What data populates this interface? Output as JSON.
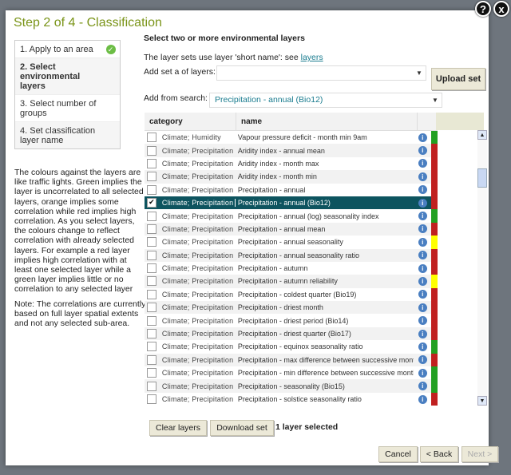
{
  "dialog": {
    "title": "Step 2 of 4 - Classification",
    "help_icon": "?",
    "close_icon": "x"
  },
  "steps": [
    {
      "label": "1. Apply to an area",
      "done": true
    },
    {
      "label": "2. Select environmental layers",
      "current": true
    },
    {
      "label": "3. Select number of groups"
    },
    {
      "label": "4. Set classification layer name"
    }
  ],
  "info": {
    "para1": "The colours against the layers are like traffic lights. Green implies the layer is uncorrelated to all selected layers, orange implies some correlation while red implies high correlation. As you select layers, the colours change to reflect correlation with already selected layers. For example a red layer implies high correlation with at least one selected layer while a green layer implies little or no correlation to any selected layer",
    "para2": "Note: The correlations are currently based on full layer spatial extents and not any selected sub-area."
  },
  "main": {
    "heading": "Select two or more environmental layers",
    "layer_sets_text": "The layer sets use layer 'short name': see ",
    "layer_sets_link": "layers",
    "add_set_label": "Add set a of layers:",
    "add_set_value": "",
    "upload_button": "Upload set",
    "search_label": "Add from search:",
    "search_value": "Precipitation - annual (Bio12)"
  },
  "grid": {
    "headers": {
      "category": "category",
      "name": "name"
    },
    "colors": {
      "green": "#22a022",
      "red": "#c02020",
      "yellow": "#ffff00"
    },
    "rows": [
      {
        "category": "Climate; Humidity",
        "name": "Vapour pressure deficit - month min 9am",
        "checked": false,
        "corr": "green"
      },
      {
        "category": "Climate; Precipitation",
        "name": "Aridity index - annual mean",
        "checked": false,
        "corr": "red"
      },
      {
        "category": "Climate; Precipitation",
        "name": "Aridity index - month max",
        "checked": false,
        "corr": "red"
      },
      {
        "category": "Climate; Precipitation",
        "name": "Aridity index - month min",
        "checked": false,
        "corr": "red"
      },
      {
        "category": "Climate; Precipitation",
        "name": "Precipitation - annual",
        "checked": false,
        "corr": "red"
      },
      {
        "category": "Climate; Precipitation",
        "name": "Precipitation - annual (Bio12)",
        "checked": true,
        "corr": "red",
        "selected": true
      },
      {
        "category": "Climate; Precipitation",
        "name": "Precipitation - annual (log) seasonality index",
        "checked": false,
        "corr": "green"
      },
      {
        "category": "Climate; Precipitation",
        "name": "Precipitation - annual mean",
        "checked": false,
        "corr": "red"
      },
      {
        "category": "Climate; Precipitation",
        "name": "Precipitation - annual seasonality",
        "checked": false,
        "corr": "yellow"
      },
      {
        "category": "Climate; Precipitation",
        "name": "Precipitation - annual seasonality ratio",
        "checked": false,
        "corr": "red"
      },
      {
        "category": "Climate; Precipitation",
        "name": "Precipitation - autumn",
        "checked": false,
        "corr": "red"
      },
      {
        "category": "Climate; Precipitation",
        "name": "Precipitation - autumn reliability",
        "checked": false,
        "corr": "yellow"
      },
      {
        "category": "Climate; Precipitation",
        "name": "Precipitation - coldest quarter (Bio19)",
        "checked": false,
        "corr": "red"
      },
      {
        "category": "Climate; Precipitation",
        "name": "Precipitation - driest month",
        "checked": false,
        "corr": "red"
      },
      {
        "category": "Climate; Precipitation",
        "name": "Precipitation - driest period (Bio14)",
        "checked": false,
        "corr": "red"
      },
      {
        "category": "Climate; Precipitation",
        "name": "Precipitation - driest quarter (Bio17)",
        "checked": false,
        "corr": "red"
      },
      {
        "category": "Climate; Precipitation",
        "name": "Precipitation - equinox seasonality ratio",
        "checked": false,
        "corr": "green"
      },
      {
        "category": "Climate; Precipitation",
        "name": "Precipitation - max difference between successive months",
        "checked": false,
        "corr": "red"
      },
      {
        "category": "Climate; Precipitation",
        "name": "Precipitation - min difference between successive months",
        "checked": false,
        "corr": "green"
      },
      {
        "category": "Climate; Precipitation",
        "name": "Precipitation - seasonality (Bio15)",
        "checked": false,
        "corr": "green"
      },
      {
        "category": "Climate; Precipitation",
        "name": "Precipitation - solstice seasonality ratio",
        "checked": false,
        "corr": "red"
      },
      {
        "category": "",
        "name": "",
        "checked": false,
        "corr": "red"
      }
    ]
  },
  "footer": {
    "clear_button": "Clear layers",
    "download_button": "Download set",
    "selection_count": "1 layer selected",
    "cancel_button": "Cancel",
    "back_button": "< Back",
    "next_button": "Next >"
  }
}
